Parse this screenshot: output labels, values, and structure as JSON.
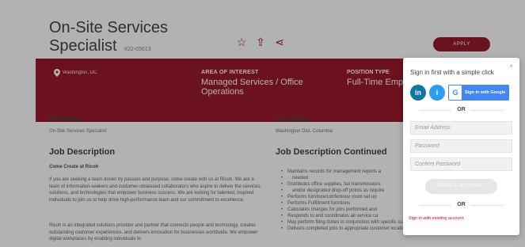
{
  "job": {
    "title": "On-Site Services Specialist",
    "id": "#22-05613",
    "apply_label": "APPLY",
    "location": "Washington, DC",
    "aoi_label": "AREA OF INTEREST",
    "aoi_value": "Managed Services / Office Operations",
    "position_type_label": "POSITION TYPE",
    "position_type_value": "Full-Time Empl"
  },
  "sections": {
    "position_heading": "Position",
    "position_value": "On-Site Services Specialist",
    "location_heading": "Location",
    "location_value": "Washington Dist. Columbia",
    "job_desc_heading": "Job Description",
    "job_desc_sub": "Come Create at Ricoh",
    "job_desc_para1": "If you are seeking a team driven by passion and purpose, come create with us at Ricoh. We are a team of information-seekers and customer-obsessed collaborators who aspire to deliver the services, solutions, and technologies that empower business success. We are looking for talented, inspired individuals to join us to help drive high-performance team and our commitment to excellence.",
    "job_desc_para2": "Ricoh is an integrated solutions provider and partner that connects people and technology, creates outstanding customer experiences, and delivers innovation for businesses worldwide. We empower digital workplaces by enabling individuals to",
    "continued_heading": "Job Description Continued",
    "bullets": [
      "Maintains records for management reports a",
      "needed",
      "Distributes office supplies, fax transmissions",
      "and/or designated drop-off points as require",
      "Performs furniture/conference room set up",
      "Performs Fulfillment functions",
      "Calculates charges for jobs performed and",
      "Responds to and coordinates all service ca",
      "May perform filing duties in conjunction with specific customer requests",
      "Delivers completed jobs to appropriate customer location within and"
    ]
  },
  "modal": {
    "title": "Sign in first with a simple click",
    "close": "×",
    "linkedin": "in",
    "indeed": "i",
    "google_logo": "G",
    "google_label": "Sign In with Google",
    "or": "OR",
    "email_placeholder": "Email Address",
    "password_placeholder": "Password",
    "confirm_placeholder": "Confirm Password",
    "create_label": "CREATE ACCOUNT",
    "existing_link": "Sign in with existing account"
  },
  "icons": {
    "star": "☆",
    "share": "⇪",
    "share_alt": "⋖",
    "pin": "⬤"
  },
  "colors": {
    "brand": "#9a1b2b",
    "linkedin": "#0e76a8",
    "indeed": "#2a9df4",
    "google": "#4285f4"
  }
}
